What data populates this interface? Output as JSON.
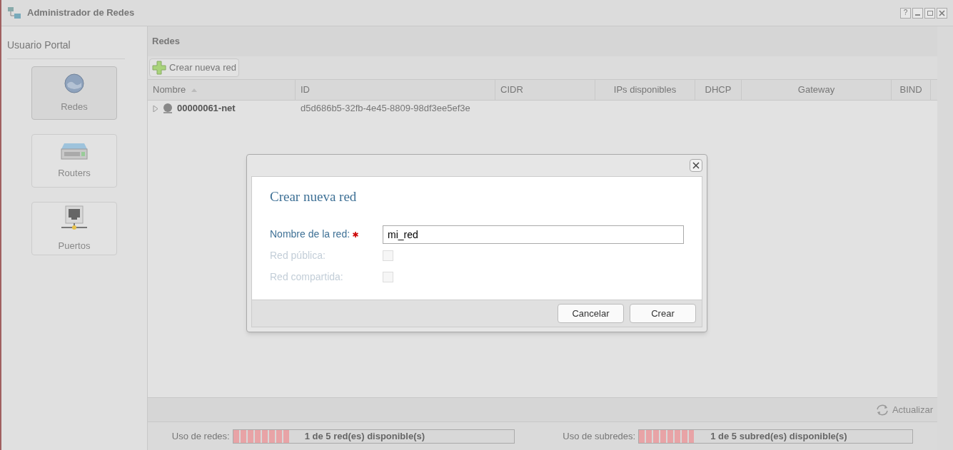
{
  "window": {
    "title": "Administrador de Redes",
    "help_label": "?"
  },
  "sidebar": {
    "title": "Usuario Portal",
    "items": [
      {
        "kind": "globe",
        "label": "Redes",
        "selected": true
      },
      {
        "kind": "router",
        "label": "Routers",
        "selected": false
      },
      {
        "kind": "port",
        "label": "Puertos",
        "selected": false
      }
    ]
  },
  "panel": {
    "title": "Redes",
    "create_button": "Crear nueva red"
  },
  "table": {
    "columns": [
      {
        "label": "Nombre",
        "sorted": true
      },
      {
        "label": "ID",
        "sorted": false
      },
      {
        "label": "CIDR",
        "sorted": false
      },
      {
        "label": "IPs disponibles",
        "sorted": false
      },
      {
        "label": "DHCP",
        "sorted": false
      },
      {
        "label": "Gateway",
        "sorted": false
      },
      {
        "label": "BIND",
        "sorted": false
      }
    ],
    "rows": [
      {
        "expanded": false,
        "name": "00000061-net",
        "id": "d5d686b5-32fb-4e45-8809-98df3ee5ef3e"
      }
    ]
  },
  "refresh_button": "Actualizar",
  "usage": [
    {
      "label": "Uso de redes:",
      "level": 0.2,
      "text": "1 de 5 red(es) disponible(s)"
    },
    {
      "label": "Uso de subredes:",
      "level": 0.2,
      "text": "1 de 5 subred(es) disponible(s)"
    }
  ],
  "dialog": {
    "title": "Crear nueva red",
    "fields": [
      {
        "kind": "text",
        "label": "Nombre de la red:",
        "required": true,
        "disabled": false,
        "value": "mi_red"
      },
      {
        "kind": "checkbox",
        "label": "Red pública:",
        "required": false,
        "disabled": true,
        "checked": false
      },
      {
        "kind": "checkbox",
        "label": "Red compartida:",
        "required": false,
        "disabled": true,
        "checked": false
      }
    ],
    "buttons": [
      "Cancelar",
      "Crear"
    ]
  }
}
